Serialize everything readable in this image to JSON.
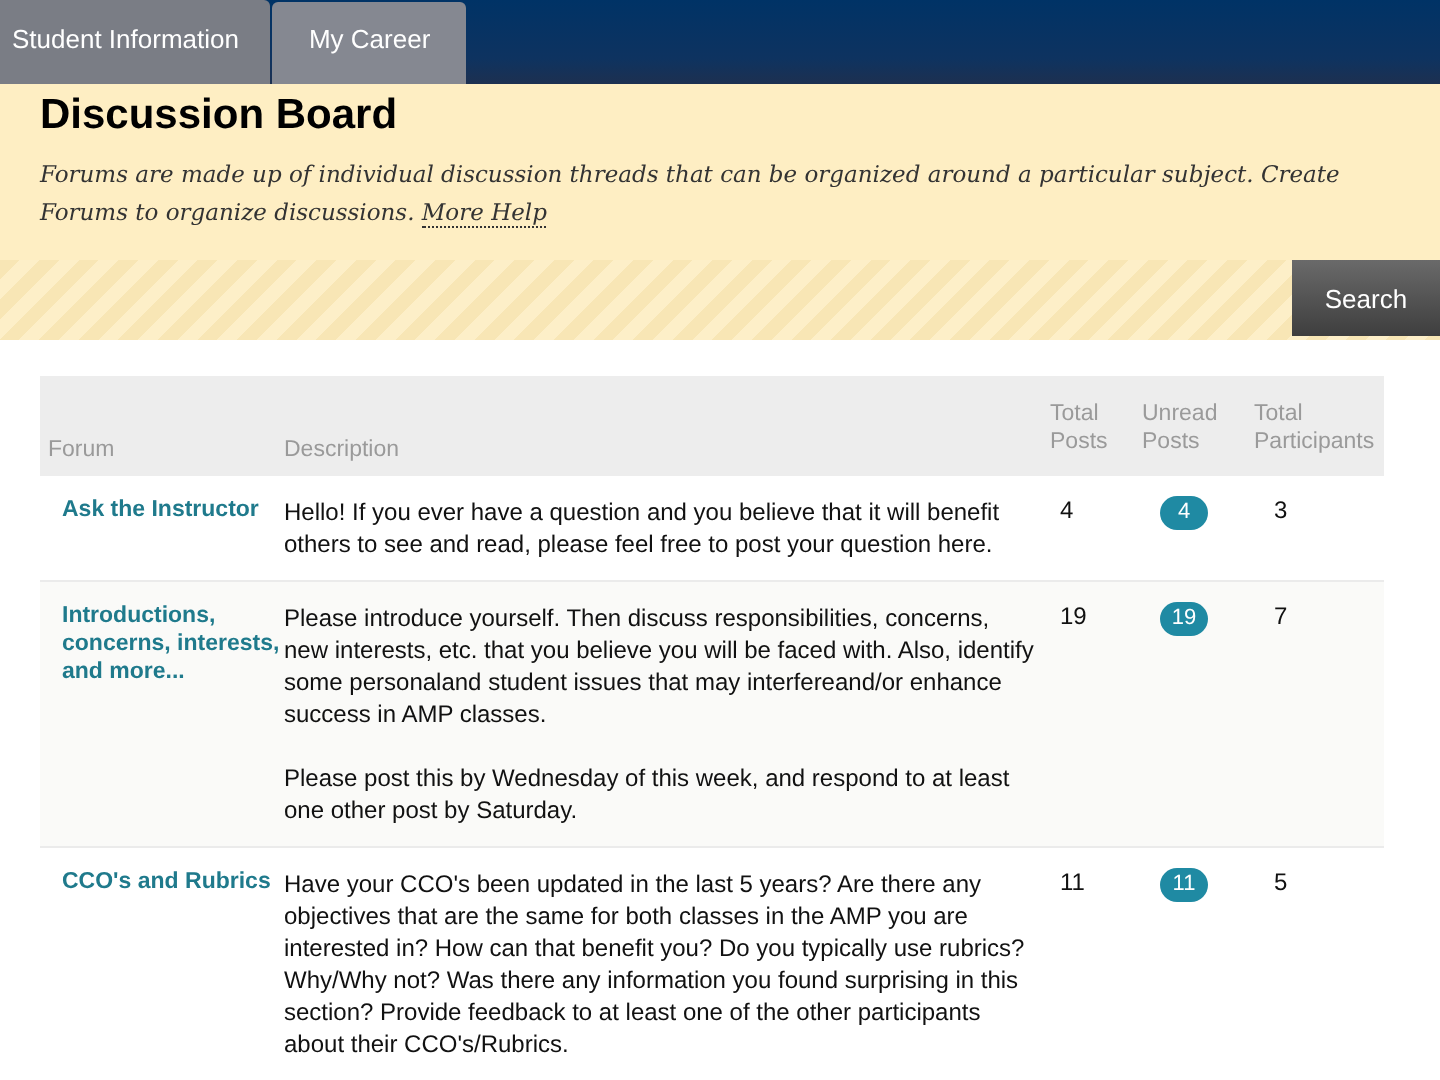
{
  "tabs": [
    {
      "label": "Student Information",
      "selected": false
    },
    {
      "label": "My Career",
      "selected": true
    }
  ],
  "header": {
    "title": "Discussion Board",
    "description": "Forums are made up of individual discussion threads that can be organized around a particular subject. Create Forums to organize discussions.",
    "help_link": "More Help"
  },
  "search_button": "Search",
  "table": {
    "columns": [
      "Forum",
      "Description",
      "Total Posts",
      "Unread Posts",
      "Total Participants"
    ],
    "rows": [
      {
        "forum": "Ask the Instructor",
        "description": [
          "Hello!  If you ever have a question  and you believe that it will benefit others to see and read, please feel free to post your question here."
        ],
        "total_posts": "4",
        "unread_posts": "4",
        "total_participants": "3"
      },
      {
        "forum": "Introductions, concerns, interests, and more...",
        "description": [
          "Please introduce yourself.   Then discuss responsibilities, concerns, new interests, etc. that you believe you will be faced with.  Also, identify some personaland student issues that may interfereand/or enhance success in AMP classes.",
          "Please post this by Wednesday of this week, and respond to at least one other post by Saturday."
        ],
        "total_posts": "19",
        "unread_posts": "19",
        "total_participants": "7"
      },
      {
        "forum": "CCO's and Rubrics",
        "description": [
          "Have your CCO's been updated in the last 5 years? Are there any objectives that are the same for both classes in the AMP you are interested in? How can that benefit you? Do you typically use rubrics? Why/Why not? Was there any information you found surprising in this section? Provide feedback to at least one of the other participants about their CCO's/Rubrics."
        ],
        "total_posts": "11",
        "unread_posts": "11",
        "total_participants": "5"
      }
    ]
  }
}
